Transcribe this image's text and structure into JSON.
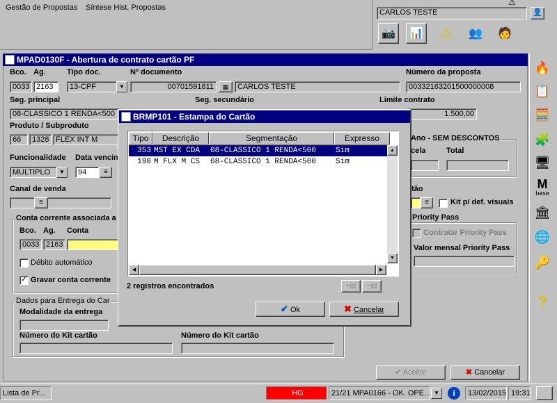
{
  "top_menu": {
    "items": [
      "Gestão de Propostas",
      "Síntese Hist. Propostas"
    ]
  },
  "user": {
    "name": "CARLOS TESTE"
  },
  "toolbar_icons": [
    "camera-icon",
    "presentation-icon",
    "warning-icon",
    "users-icon",
    "person-info-icon"
  ],
  "main_window": {
    "title": "MPAD0130F - Abertura de contrato cartão PF",
    "labels": {
      "bco": "Bco.",
      "ag": "Ag.",
      "tipo_doc": "Tipo doc.",
      "num_doc": "Nº documento",
      "num_proposta": "Número da proposta",
      "seg_principal": "Seg. principal",
      "seg_secundario": "Seg. secundário",
      "limite_contrato": "Limite contrato",
      "produto": "Produto / Subproduto",
      "funcionalidade": "Funcionalidade",
      "data_vencimento": "Data vencin",
      "canal_venda": "Canal de venda",
      "anuidade": "Ano - SEM DESCONTOS",
      "parcela": "cela",
      "total": "Total",
      "cartao": "tão",
      "kit_visuais": "Kit p/ def. visuais",
      "priority_pass": "Priority Pass",
      "contratar_pp": "Contratar Priority Pass",
      "valor_pp": "Valor mensal Priority Pass",
      "conta_group": "Conta corrente associada a",
      "bco2": "Bco.",
      "ag2": "Ag.",
      "conta": "Conta",
      "debito_auto": "Débito automático",
      "gravar_conta": "Gravar conta corrente",
      "entrega_group": "Dados para Entrega do Car",
      "modalidade": "Modalidade da entrega",
      "kit1": "Número do Kit cartão",
      "kit2": "Número do Kit cartão"
    },
    "values": {
      "bco": "0033",
      "ag": "2163",
      "tipo_doc": "13-CPF",
      "num_doc": "00701591811",
      "nome": "CARLOS TESTE",
      "num_proposta": "00332163201500000008",
      "seg_principal": "08-CLASSICO 1 RENDA<500",
      "limite": "1.500,00",
      "produto": "66",
      "subproduto": "1328",
      "produto_nome": "FLEX INT M",
      "funcionalidade": "MULTIPLO",
      "data_vencimento": "94",
      "conta_bco": "0033",
      "conta_ag": "2163",
      "conta_num": "",
      "debito_auto": false,
      "gravar_conta": true
    },
    "buttons": {
      "aceitar": "Aceitar",
      "cancelar": "Cancelar"
    }
  },
  "dialog": {
    "title": "BRMP101 - Estampa do Cartão",
    "columns": [
      "Tipo",
      "Descrição",
      "Segmentação",
      "Expresso"
    ],
    "rows": [
      {
        "tipo": "353",
        "descricao": "MST EX CDA",
        "segmentacao": "08-CLASSICO 1 RENDA<500",
        "expresso": "Sim",
        "selected": true
      },
      {
        "tipo": "198",
        "descricao": "M FLX M CS",
        "segmentacao": "08-CLASSICO 1 RENDA<500",
        "expresso": "Sim",
        "selected": false
      }
    ],
    "record_count": "2 registros encontrados",
    "ok_label": "Ok",
    "cancel_label": "Cancelar"
  },
  "side_icons": [
    "bank-logo-icon",
    "form-icon",
    "calculator-icon",
    "puzzle-icon",
    "computer-icon",
    "mbase-icon",
    "fn-icon",
    "globe-icon",
    "key-icon",
    "help-icon"
  ],
  "side_mbase_label": "base",
  "side_mbase_letter": "M",
  "statusbar": {
    "task": "Lista de Pr...",
    "hg": "HG",
    "message": "21/21 MPA0166 - OK. OPE...",
    "date": "13/02/2015",
    "time": "19:31"
  },
  "colors": {
    "titlebar": "#000080",
    "face": "#c0c0c0",
    "hg_red": "#ff0000",
    "highlight": "#ffff80"
  }
}
